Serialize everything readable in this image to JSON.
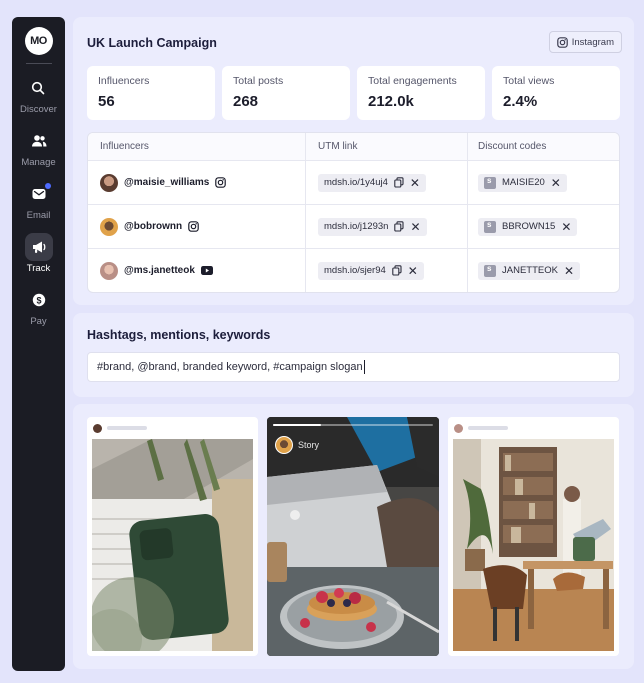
{
  "sidebar": {
    "logo": "MO",
    "items": [
      {
        "label": "Discover",
        "icon": "search-icon"
      },
      {
        "label": "Manage",
        "icon": "users-icon"
      },
      {
        "label": "Email",
        "icon": "mail-icon"
      },
      {
        "label": "Track",
        "icon": "megaphone-icon"
      },
      {
        "label": "Pay",
        "icon": "dollar-icon"
      }
    ],
    "active": "Track"
  },
  "campaign": {
    "title": "UK Launch Campaign",
    "platform": "Instagram",
    "stats": [
      {
        "label": "Influencers",
        "value": "56"
      },
      {
        "label": "Total posts",
        "value": "268"
      },
      {
        "label": "Total engagements",
        "value": "212.0k"
      },
      {
        "label": "Total views",
        "value": "2.4%"
      }
    ]
  },
  "table": {
    "headers": [
      "Influencers",
      "UTM link",
      "Discount codes"
    ],
    "rows": [
      {
        "handle": "@maisie_williams",
        "platform_icon": "instagram-icon",
        "utm": "mdsh.io/1y4uj4",
        "code": "MAISIE20"
      },
      {
        "handle": "@bobrownn",
        "platform_icon": "instagram-icon",
        "utm": "mdsh.io/j1293n",
        "code": "BBROWN15"
      },
      {
        "handle": "@ms.janetteok",
        "platform_icon": "youtube-icon",
        "utm": "mdsh.io/sjer94",
        "code": "JANETTEOK"
      }
    ]
  },
  "keywords": {
    "title": "Hashtags, mentions, keywords",
    "value": "#brand, @brand, branded keyword, #campaign slogan"
  },
  "posts": {
    "story_label": "Story"
  },
  "colors": {
    "sidebar_bg": "#1b1c24",
    "page_bg": "#e3e4fb",
    "notification_dot": "#4e6bff"
  }
}
